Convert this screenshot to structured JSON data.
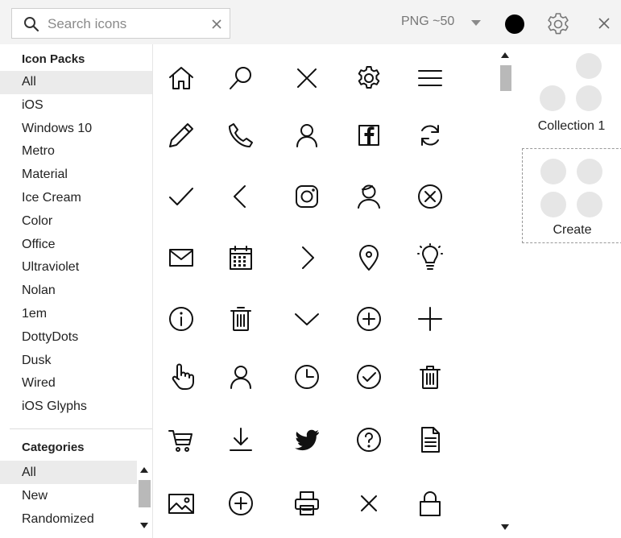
{
  "search": {
    "placeholder": "Search icons",
    "value": ""
  },
  "toolbar": {
    "format_label": "PNG ~50",
    "color": "#000000"
  },
  "sidebar": {
    "packs_heading": "Icon Packs",
    "packs": [
      "All",
      "iOS",
      "Windows 10",
      "Metro",
      "Material",
      "Ice Cream",
      "Color",
      "Office",
      "Ultraviolet",
      "Nolan",
      "1em",
      "DottyDots",
      "Dusk",
      "Wired",
      "iOS Glyphs"
    ],
    "active_pack": "All",
    "categories_heading": "Categories",
    "categories": [
      "All",
      "New",
      "Randomized"
    ],
    "active_category": "All"
  },
  "icons": [
    "home-icon",
    "search-icon",
    "close-icon",
    "settings-icon",
    "menu-icon",
    "pencil-icon",
    "phone-icon",
    "user-icon",
    "facebook-icon",
    "refresh-icon",
    "checkmark-icon",
    "chevron-left-icon",
    "instagram-icon",
    "user-male-icon",
    "cancel-circle-icon",
    "mail-icon",
    "calendar-icon",
    "chevron-right-icon",
    "location-pin-icon",
    "lightbulb-icon",
    "info-icon",
    "trash-icon",
    "chevron-down-icon",
    "plus-circle-icon",
    "plus-icon",
    "hand-cursor-icon",
    "user-outline-icon",
    "clock-icon",
    "check-circle-icon",
    "delete-icon",
    "cart-icon",
    "download-icon",
    "twitter-icon",
    "help-icon",
    "document-icon",
    "image-icon",
    "add-circle-icon",
    "print-icon",
    "multiply-icon",
    "lock-icon"
  ],
  "collections": [
    {
      "name": "Collection 1"
    }
  ],
  "create_label": "Create"
}
